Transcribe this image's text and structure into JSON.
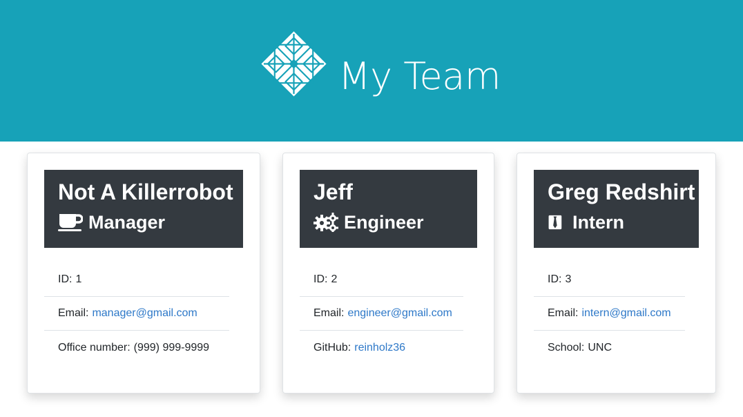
{
  "header": {
    "title": "My Team",
    "logo_icon": "centos-logo-icon",
    "background_color": "#17a2b8"
  },
  "employees": [
    {
      "name": "Not A Killerrobot",
      "role": "Manager",
      "role_icon": "coffee-mug-icon",
      "id_label": "ID:",
      "id_value": "1",
      "email_label": "Email:",
      "email_value": "manager@gmail.com",
      "extra_label": "Office number:",
      "extra_value": "(999) 999-9999"
    },
    {
      "name": "Jeff",
      "role": "Engineer",
      "role_icon": "gears-icon",
      "id_label": "ID:",
      "id_value": "2",
      "email_label": "Email:",
      "email_value": "engineer@gmail.com",
      "extra_label": "GitHub:",
      "extra_value": "reinholz36"
    },
    {
      "name": "Greg Redshirt",
      "role": "Intern",
      "role_icon": "necktie-icon",
      "id_label": "ID:",
      "id_value": "3",
      "email_label": "Email:",
      "email_value": "intern@gmail.com",
      "extra_label": "School:",
      "extra_value": "UNC"
    }
  ],
  "colors": {
    "card_header": "#343a40",
    "link": "#2d78c8"
  }
}
